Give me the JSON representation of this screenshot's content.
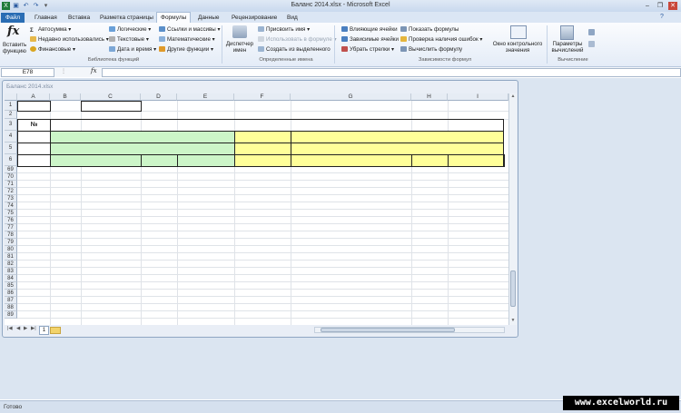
{
  "window": {
    "title": "Баланс 2014.xlsx - Microsoft Excel"
  },
  "tabs": [
    "Файл",
    "Главная",
    "Вставка",
    "Разметка страницы",
    "Формулы",
    "Данные",
    "Рецензирование",
    "Вид"
  ],
  "active_tab": "Формулы",
  "ribbon": {
    "insert_function": "Вставить функцию",
    "library": {
      "autosum": "Автосумма",
      "recent": "Недавно использовались",
      "financial": "Финансовые",
      "logical": "Логические",
      "text": "Текстовые",
      "datetime": "Дата и время",
      "lookup": "Ссылки и массивы",
      "math": "Математические",
      "more": "Другие функции",
      "group_label": "Библиотека функций"
    },
    "names": {
      "manager": "Диспетчер имен",
      "define": "Присвоить имя",
      "use_in_formula": "Использовать в формуле",
      "create_from_selection": "Создать из выделенного",
      "group_label": "Определенные имена"
    },
    "audit": {
      "trace_precedents": "Влияющие ячейки",
      "trace_dependents": "Зависимые ячейки",
      "remove_arrows": "Убрать стрелки",
      "show_formulas": "Показать формулы",
      "error_checking": "Проверка наличия ошибок",
      "evaluate": "Вычислить формулу",
      "watch_window": "Окно контрольного значения",
      "group_label": "Зависимости формул"
    },
    "calc": {
      "options": "Параметры вычислений",
      "group_label": "Вычисление"
    }
  },
  "formula_bar": {
    "name_box": "E78",
    "fx": "fx",
    "value": ""
  },
  "workbook": {
    "title": "Баланс 2014.xlsx",
    "columns": [
      "A",
      "B",
      "C",
      "D",
      "E",
      "F",
      "G",
      "H",
      "I"
    ],
    "top_rows": [
      "1",
      "2",
      "3",
      "4",
      "5",
      "6"
    ],
    "rows": [
      "69",
      "70",
      "71",
      "72",
      "73",
      "74",
      "75",
      "76",
      "77",
      "78",
      "79",
      "80",
      "81",
      "82",
      "83",
      "84",
      "85",
      "86",
      "87",
      "88",
      "89"
    ],
    "cell_A3": "№",
    "sheet_tab": "1"
  },
  "status": {
    "text": "Готово"
  },
  "watermark": "www.excelworld.ru",
  "colors": {
    "green_fill": "#ccf5c8",
    "yellow_fill": "#ffff99",
    "file_tab": "#2a6db4"
  }
}
